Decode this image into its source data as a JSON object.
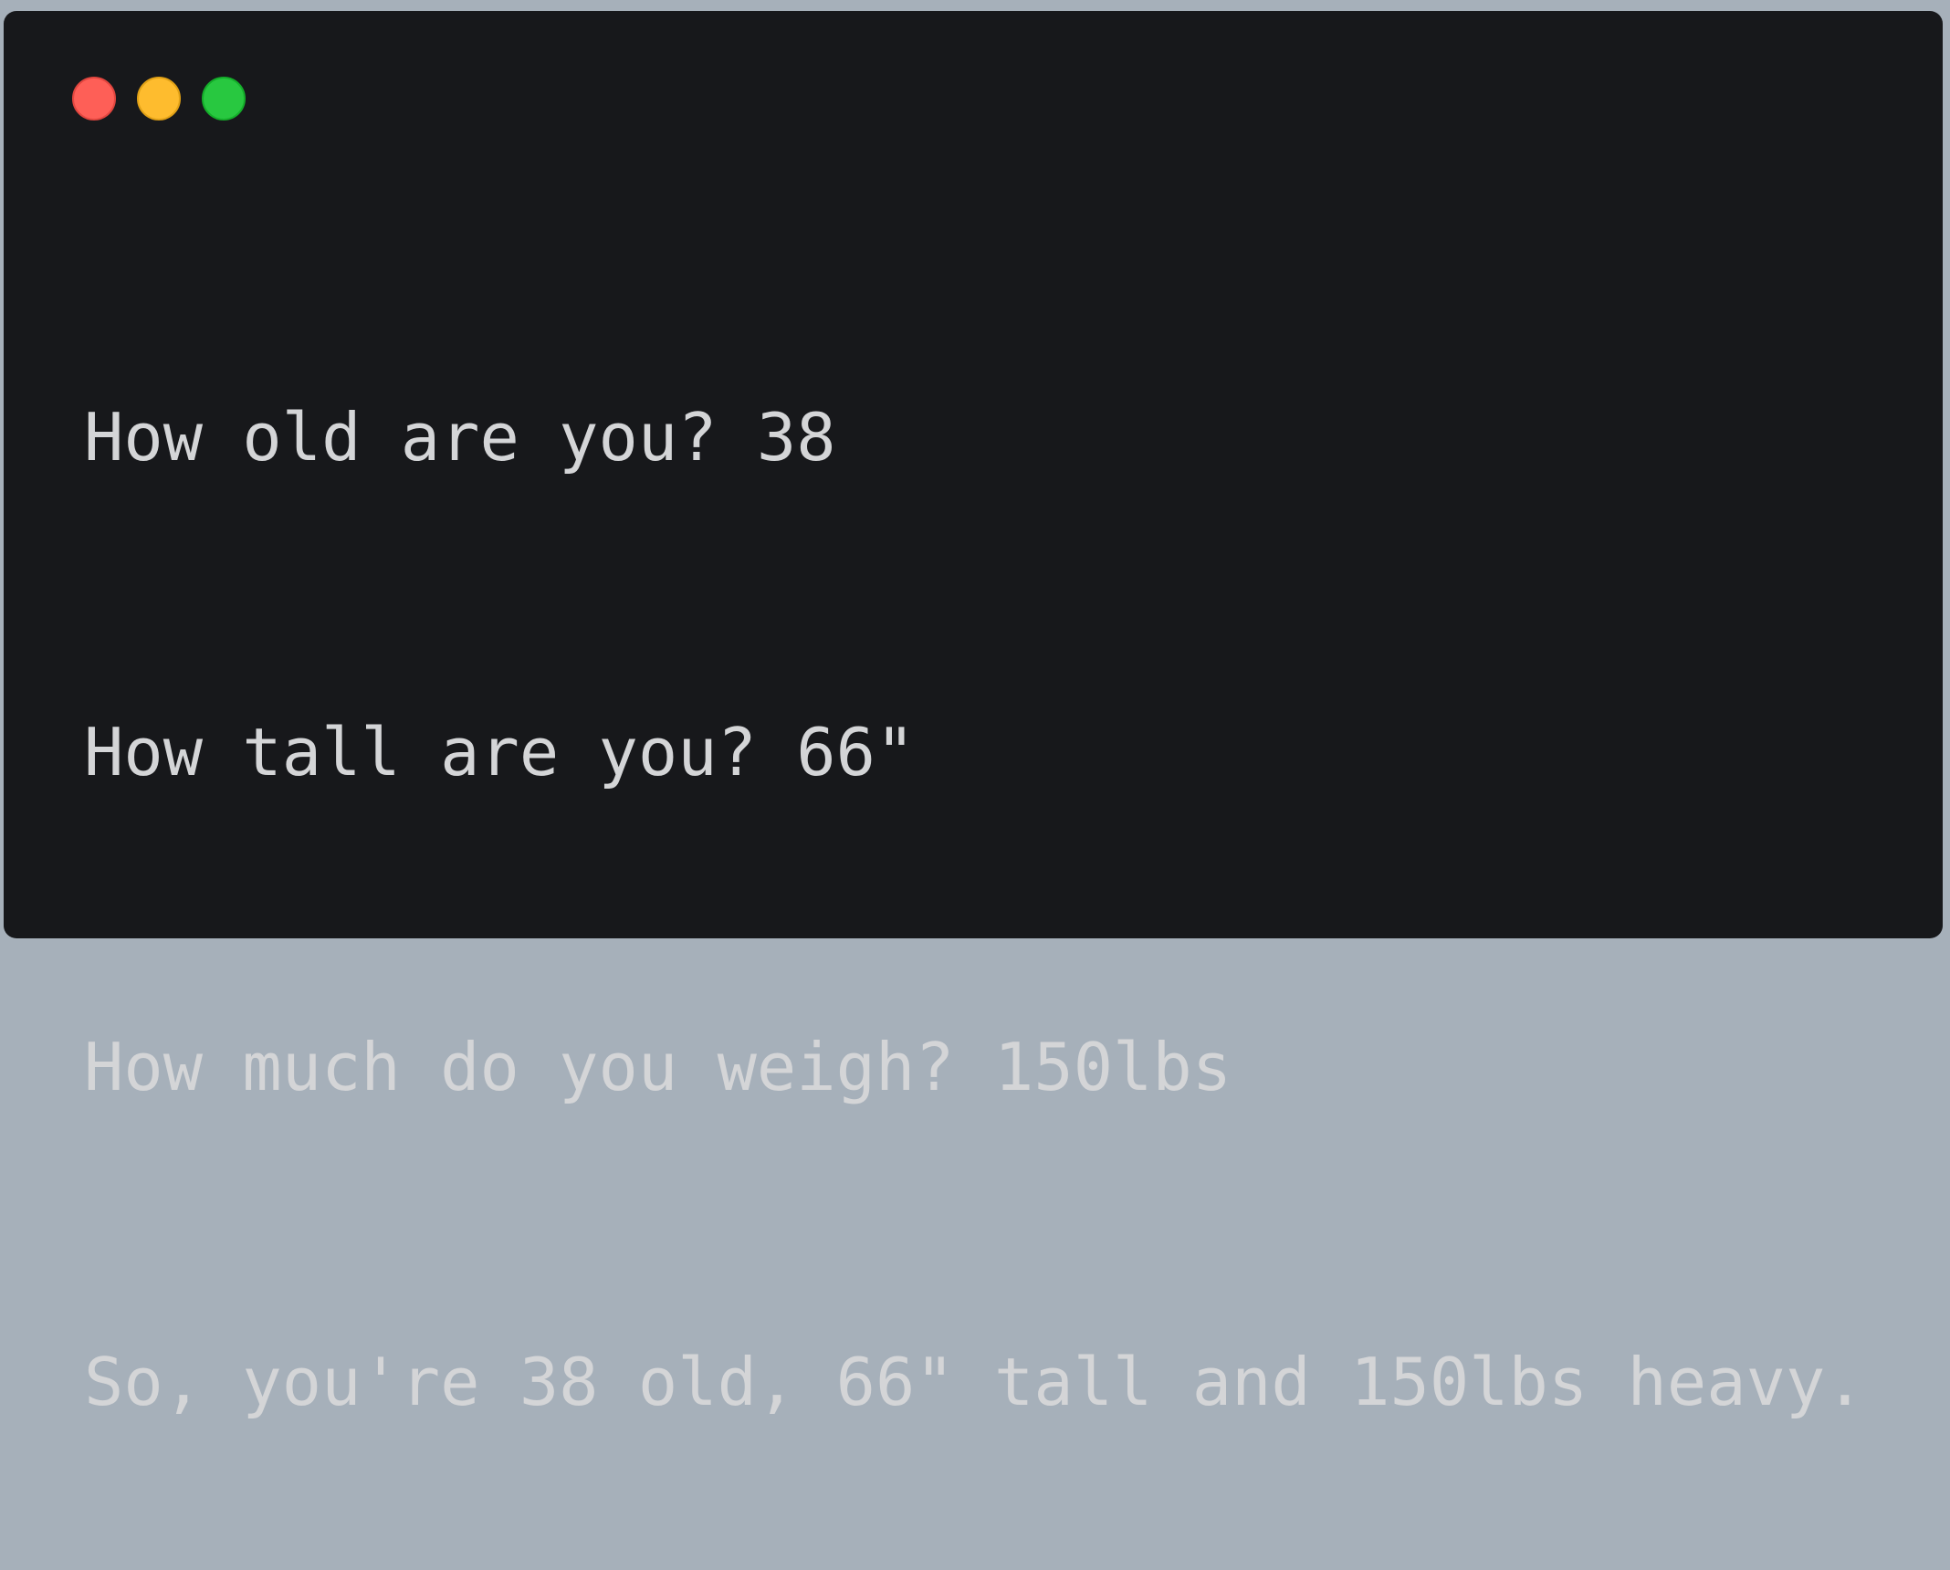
{
  "window": {
    "controls": {
      "close_color": "#fe5f57",
      "minimize_color": "#febc2e",
      "zoom_color": "#28c840"
    },
    "background_color": "#17181b",
    "text_color": "#d4d5d7"
  },
  "output": {
    "lines": [
      "How old are you? 38",
      "How tall are you? 66\"",
      "How much do you weigh? 150lbs",
      "So, you're 38 old, 66\" tall and 150lbs heavy."
    ]
  }
}
